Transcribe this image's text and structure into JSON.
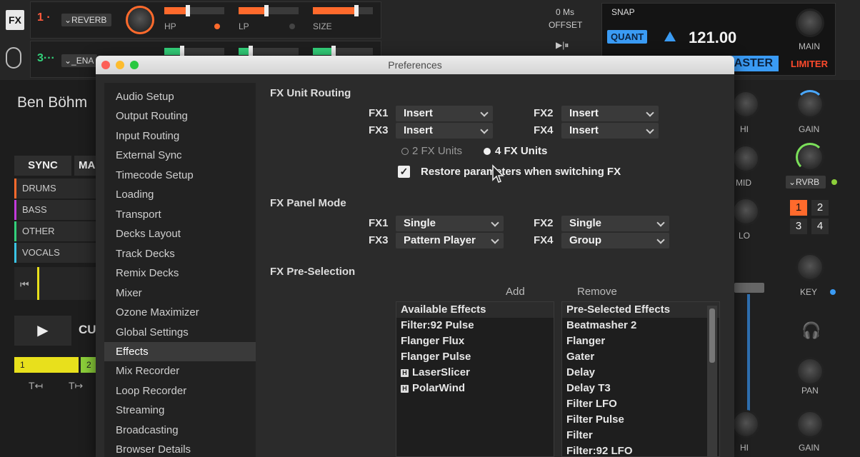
{
  "fx_panel": {
    "badge": "FX",
    "unit1": {
      "number": "1 ·",
      "effect": "⌄REVERB",
      "knob_labels": [
        "HP",
        "LP",
        "SIZE"
      ]
    },
    "unit3": {
      "number": "3···",
      "effect": "⌄_ENA"
    }
  },
  "offset": {
    "value": "0 Ms",
    "label": "OFFSET",
    "controls": "▶|⏸"
  },
  "tempo": {
    "snap": "SNAP",
    "quant": "QUANT",
    "bpm": "121.00",
    "master": "ASTER",
    "main": "MAIN",
    "limiter": "LIMITER"
  },
  "deck": {
    "artist": "Ben Böhm",
    "sync": "SYNC",
    "master_partial": "MA",
    "stems": [
      "DRUMS",
      "BASS",
      "OTHER",
      "VOCALS"
    ],
    "cue_partial": "CU",
    "cue_points": [
      "1",
      "2"
    ],
    "play_icon": "▶"
  },
  "mixer": {
    "hi": "HI",
    "mid": "MID",
    "lo": "LO",
    "gain": "GAIN",
    "fx_select": "⌄RVRB",
    "fx_buttons": [
      "1",
      "2",
      "3",
      "4"
    ],
    "key": "KEY",
    "pan": "PAN",
    "gain2": "GAIN",
    "hi2": "HI"
  },
  "colors": {
    "accent_blue": "#3a9bf4",
    "accent_orange": "#ff6a2c",
    "accent_green": "#33d17a"
  },
  "prefs": {
    "title": "Preferences",
    "nav": [
      "Audio Setup",
      "Output Routing",
      "Input Routing",
      "External Sync",
      "Timecode Setup",
      "Loading",
      "Transport",
      "Decks Layout",
      "Track Decks",
      "Remix Decks",
      "Mixer",
      "Ozone Maximizer",
      "Global Settings",
      "Effects",
      "Mix Recorder",
      "Loop Recorder",
      "Streaming",
      "Broadcasting",
      "Browser Details"
    ],
    "active_nav": "Effects",
    "routing": {
      "title": "FX Unit Routing",
      "fx1_label": "FX1",
      "fx1_value": "Insert",
      "fx2_label": "FX2",
      "fx2_value": "Insert",
      "fx3_label": "FX3",
      "fx3_value": "Insert",
      "fx4_label": "FX4",
      "fx4_value": "Insert",
      "opt_two": "2 FX Units",
      "opt_four": "4 FX Units",
      "restore": "Restore parameters when switching FX"
    },
    "panel_mode": {
      "title": "FX Panel Mode",
      "fx1_label": "FX1",
      "fx1_value": "Single",
      "fx2_label": "FX2",
      "fx2_value": "Single",
      "fx3_label": "FX3",
      "fx3_value": "Pattern Player",
      "fx4_label": "FX4",
      "fx4_value": "Group"
    },
    "preselection": {
      "title": "FX Pre-Selection",
      "add": "Add",
      "remove": "Remove",
      "available_header": "Available Effects",
      "available": [
        "Filter:92 Pulse",
        "Flanger Flux",
        "Flanger Pulse",
        "LaserSlicer",
        "PolarWind"
      ],
      "preselected_header": "Pre-Selected Effects",
      "preselected": [
        "Beatmasher 2",
        "Flanger",
        "Gater",
        "Delay",
        "Delay T3",
        "Filter LFO",
        "Filter Pulse",
        "Filter",
        "Filter:92 LFO"
      ]
    }
  }
}
